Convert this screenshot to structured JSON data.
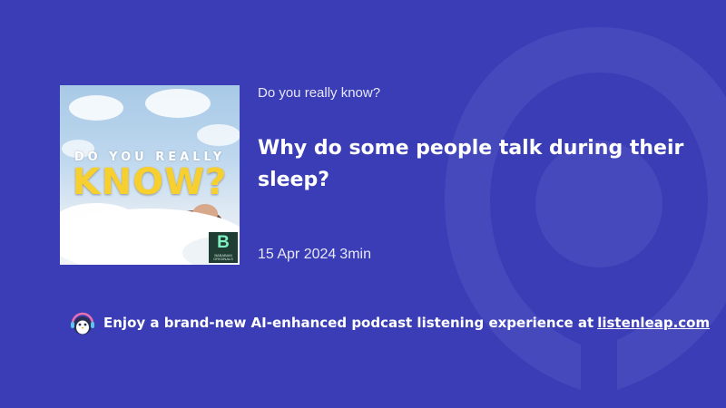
{
  "podcast": {
    "show_name": "Do you really know?",
    "episode_title": "Why do some people talk during their sleep?",
    "date": "15 Apr 2024",
    "duration": "3min"
  },
  "cover": {
    "line1": "DO YOU REALLY",
    "line2": "KNOW?",
    "badge_letter": "B",
    "badge_text": "BABABAM ORIGINALS"
  },
  "promo": {
    "text": "Enjoy a brand-new AI-enhanced podcast listening experience at",
    "link_label": "listenleap.com"
  },
  "colors": {
    "background": "#3a3db5",
    "cover_title": "#f7cf2e",
    "text": "#ffffff"
  },
  "icons": {
    "background_logo": "listenleap-logo-watermark",
    "mascot": "penguin-headphones-icon"
  }
}
